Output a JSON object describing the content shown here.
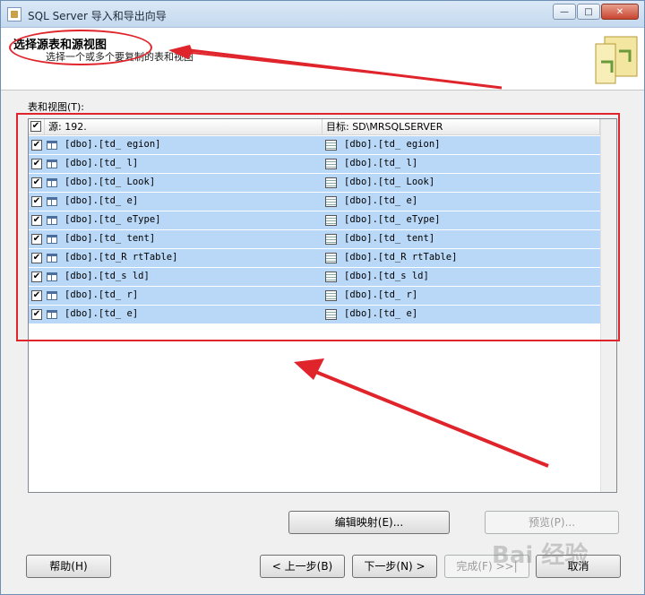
{
  "window": {
    "title": "SQL Server 导入和导出向导",
    "controls": [
      "—",
      "□",
      "✕"
    ]
  },
  "header": {
    "title": "选择源表和源视图",
    "subtitle": "选择一个或多个要复制的表和视图"
  },
  "list": {
    "label": "表和视图(T):",
    "columns": {
      "source": "源: 192.",
      "destination": "目标: SD\\MRSQLSERVER"
    },
    "rows": [
      {
        "checked": true,
        "source": "[dbo].[td_   egion]",
        "destination": "[dbo].[td_   egion]"
      },
      {
        "checked": true,
        "source": "[dbo].[td_   l]",
        "destination": "[dbo].[td_   l]"
      },
      {
        "checked": true,
        "source": "[dbo].[td_   Look]",
        "destination": "[dbo].[td_   Look]"
      },
      {
        "checked": true,
        "source": "[dbo].[td_   e]",
        "destination": "[dbo].[td_   e]"
      },
      {
        "checked": true,
        "source": "[dbo].[td_   eType]",
        "destination": "[dbo].[td_   eType]"
      },
      {
        "checked": true,
        "source": "[dbo].[td_   tent]",
        "destination": "[dbo].[td_   tent]"
      },
      {
        "checked": true,
        "source": "[dbo].[td_R   rtTable]",
        "destination": "[dbo].[td_R   rtTable]"
      },
      {
        "checked": true,
        "source": "[dbo].[td_s   ld]",
        "destination": "[dbo].[td_s   ld]"
      },
      {
        "checked": true,
        "source": "[dbo].[td_   r]",
        "destination": "[dbo].[td_   r]"
      },
      {
        "checked": true,
        "source": "[dbo].[td_   e]",
        "destination": "[dbo].[td_   e]"
      }
    ]
  },
  "buttons": {
    "edit_mappings": "编辑映射(E)...",
    "preview": "预览(P)...",
    "help": "帮助(H)",
    "back": "< 上一步(B)",
    "next": "下一步(N) >",
    "finish": "完成(F) >>|",
    "cancel": "取消"
  },
  "watermark": "Bai 经验",
  "colors": {
    "annotation": "#e0242b",
    "row_selected": "#b9d8f7"
  }
}
